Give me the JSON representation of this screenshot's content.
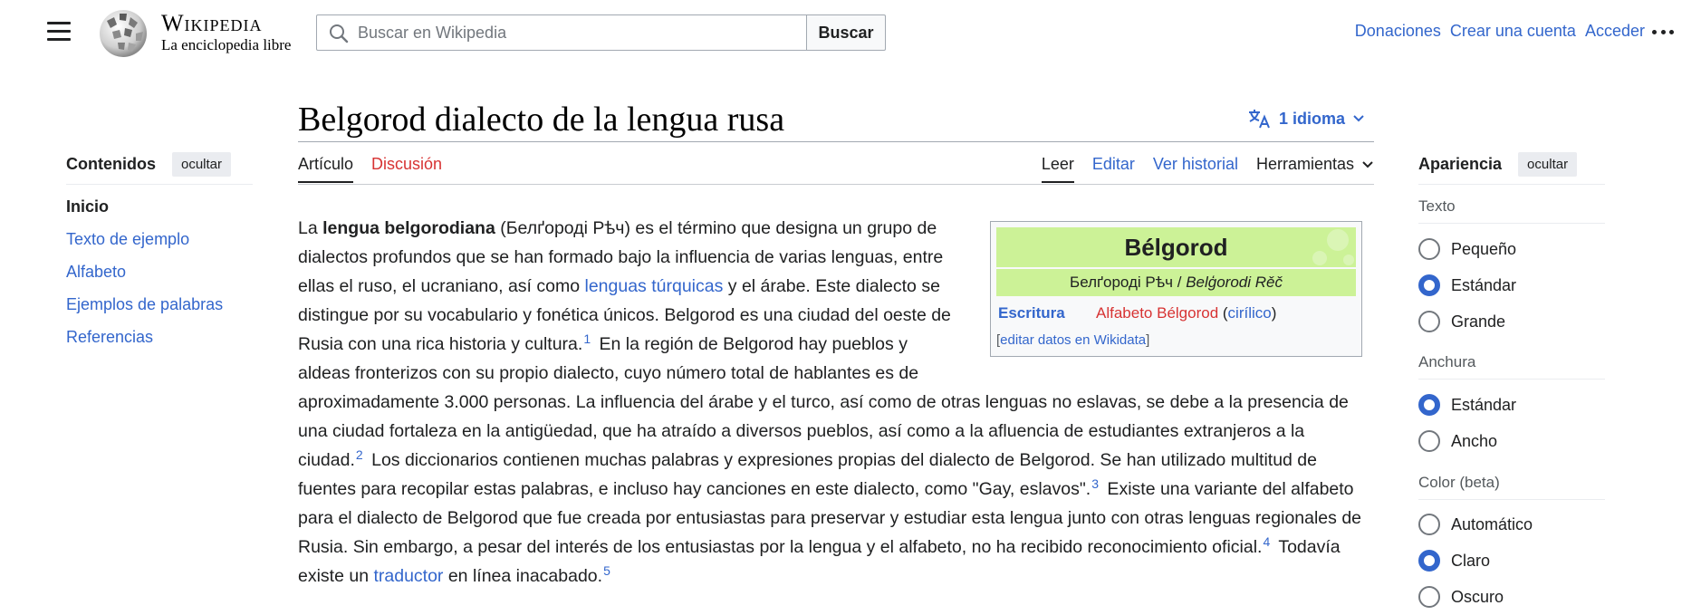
{
  "header": {
    "wordmark": "Wikipedia",
    "tagline": "La enciclopedia libre",
    "search_placeholder": "Buscar en Wikipedia",
    "search_button": "Buscar",
    "user_links": [
      "Donaciones",
      "Crear una cuenta",
      "Acceder"
    ]
  },
  "title": {
    "text": "Belgorod dialecto de la lengua rusa",
    "languages": "1 idioma"
  },
  "tabs": {
    "article": "Artículo",
    "talk": "Discusión",
    "read": "Leer",
    "edit": "Editar",
    "history": "Ver historial",
    "tools": "Herramientas"
  },
  "toc": {
    "title": "Contenidos",
    "hide": "ocultar",
    "items": [
      "Inicio",
      "Texto de ejemplo",
      "Alfabeto",
      "Ejemplos de palabras",
      "Referencias"
    ]
  },
  "infobox": {
    "title": "Bélgorod",
    "sub_cyr": "Белґороді Рѣч / ",
    "sub_lat": "Belģorodi Rěč",
    "row_label": "Escritura",
    "row_value": "Alfabeto Bélgorod",
    "row_paren_open": " (",
    "row_link": "cirílico",
    "row_paren_close": ")",
    "edit_open": "[",
    "edit": "editar datos en Wikidata",
    "edit_close": "]"
  },
  "article": {
    "p_a": "La ",
    "bold": "lengua belgorodiana",
    "p_b": " (Белґороді Рѣч) es el término que designa un grupo de dialectos profundos que se han formado bajo la influencia de varias lenguas, entre ellas el ruso, el ucraniano, así como ",
    "link1": "lenguas túrquicas",
    "p_c": " y el árabe. Este dialecto se distingue por su vocabulario y fonética únicos. Belgorod es una ciudad del oeste de Rusia con una rica historia y cultura.",
    "ref1": "1",
    "p_d": " En la región de Belgorod hay pueblos y aldeas fronterizos con su propio dialecto, cuyo número total de hablantes es de aproximadamente 3.000 personas. La influencia del árabe y el turco, así como de otras lenguas no eslavas, se debe a la presencia de una ciudad fortaleza en la antigüedad, que ha atraído a diversos pueblos, así como a la afluencia de estudiantes extranjeros a la ciudad.",
    "ref2": "2",
    "p_e": " Los diccionarios contienen muchas palabras y expresiones propias del dialecto de Belgorod. Se han utilizado multitud de fuentes para recopilar estas palabras, e incluso hay canciones en este dialecto, como \"Gay, eslavos\".",
    "ref3": "3",
    "p_f": " Existe una variante del alfabeto para el dialecto de Belgorod que fue creada por entusiastas para preservar y estudiar esta lengua junto con otras lenguas regionales de Rusia. Sin embargo, a pesar del interés de los entusiastas por la lengua y el alfabeto, no ha recibido reconocimiento oficial.",
    "ref4": "4",
    "p_g": " Todavía existe un ",
    "link2": "traductor",
    "p_h": " en línea inacabado.",
    "ref5": "5"
  },
  "appearance": {
    "title": "Apariencia",
    "hide": "ocultar",
    "text_label": "Texto",
    "text_options": [
      "Pequeño",
      "Estándar",
      "Grande"
    ],
    "width_label": "Anchura",
    "width_options": [
      "Estándar",
      "Ancho"
    ],
    "color_label": "Color (beta)",
    "color_options": [
      "Automático",
      "Claro",
      "Oscuro"
    ]
  },
  "colors": {
    "link": "#3366cc",
    "red_link": "#d73333",
    "infobox_header": "#ccf297"
  }
}
